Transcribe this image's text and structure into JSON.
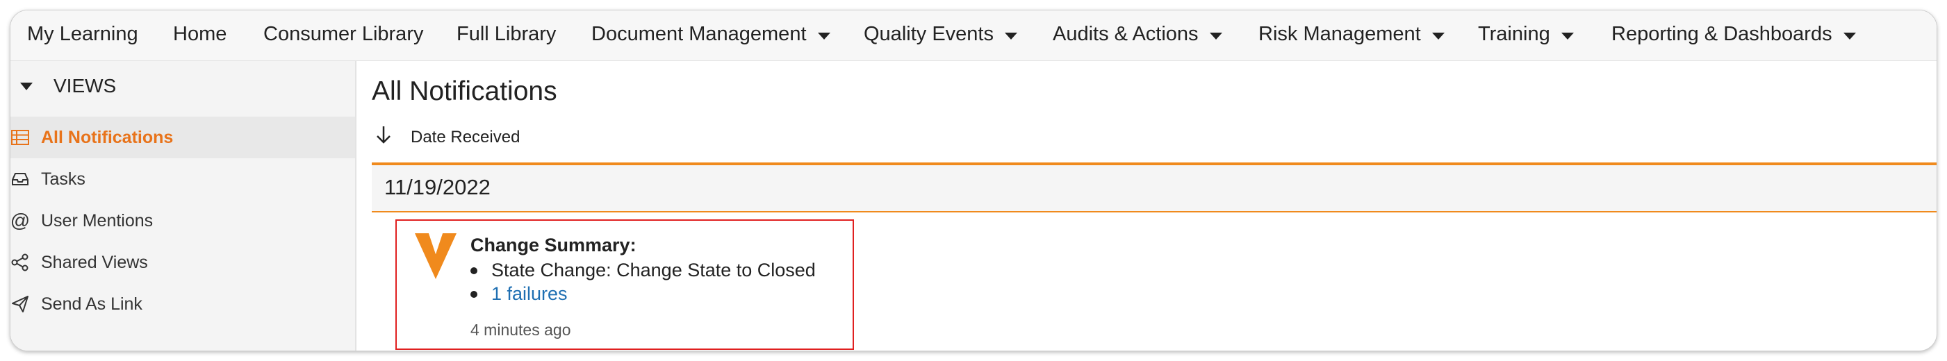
{
  "topnav": {
    "items": [
      {
        "label": "My Learning",
        "dropdown": false
      },
      {
        "label": "Home",
        "dropdown": false
      },
      {
        "label": "Consumer Library",
        "dropdown": false
      },
      {
        "label": "Full Library",
        "dropdown": false
      },
      {
        "label": "Document Management",
        "dropdown": true
      },
      {
        "label": "Quality Events",
        "dropdown": true
      },
      {
        "label": "Audits & Actions",
        "dropdown": true
      },
      {
        "label": "Risk Management",
        "dropdown": true
      },
      {
        "label": "Training",
        "dropdown": true
      },
      {
        "label": "Reporting & Dashboards",
        "dropdown": true
      }
    ]
  },
  "sidebar": {
    "header": "VIEWS",
    "items": [
      {
        "label": "All Notifications",
        "icon": "table-icon",
        "active": true
      },
      {
        "label": "Tasks",
        "icon": "inbox-icon",
        "active": false
      },
      {
        "label": "User Mentions",
        "icon": "at-icon",
        "active": false
      },
      {
        "label": "Shared Views",
        "icon": "share-icon",
        "active": false
      },
      {
        "label": "Send As Link",
        "icon": "paper-plane-icon",
        "active": false
      }
    ]
  },
  "main": {
    "title": "All Notifications",
    "sort_label": "Date Received",
    "date_group": "11/19/2022",
    "notification": {
      "summary_label": "Change Summary:",
      "bullets": [
        {
          "text": "State Change: Change State to Closed",
          "link": false
        },
        {
          "text": "1 failures",
          "link": true
        }
      ],
      "time_ago": "4 minutes ago"
    }
  },
  "colors": {
    "accent": "#e8731a",
    "band_border": "#f08a1d",
    "highlight_box": "#e02020",
    "link": "#1f6fb2"
  }
}
